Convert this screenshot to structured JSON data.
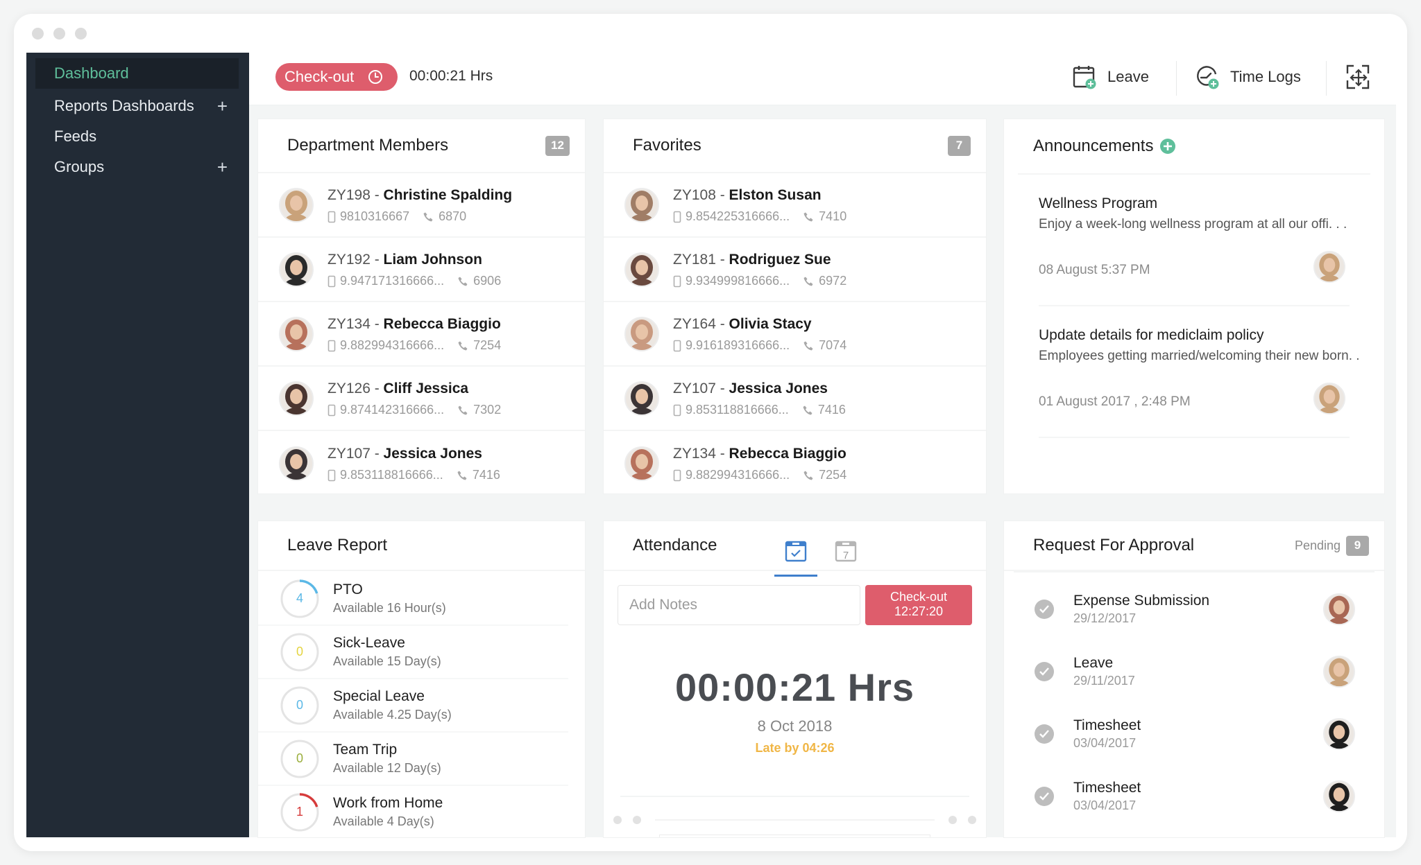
{
  "window": {
    "controls": [
      "close",
      "minimize",
      "maximize"
    ]
  },
  "sidebar": {
    "items": [
      {
        "label": "Dashboard",
        "active": true,
        "has_add": false
      },
      {
        "label": "Reports Dashboards",
        "active": false,
        "has_add": true
      },
      {
        "label": "Feeds",
        "active": false,
        "has_add": false
      },
      {
        "label": "Groups",
        "active": false,
        "has_add": true
      }
    ],
    "add_symbol": "+"
  },
  "topbar": {
    "checkout_label": "Check-out",
    "checkout_icon": "clock-icon",
    "timer": "00:00:21 Hrs",
    "actions": [
      {
        "label": "Leave",
        "icon": "calendar-add-icon"
      },
      {
        "label": "Time Logs",
        "icon": "timelog-add-icon"
      }
    ],
    "expand_icon": "move-expand-icon"
  },
  "colors": {
    "accent_green": "#5fbf9b",
    "checkout_red": "#de5d6c",
    "sidebar_bg": "#222b36",
    "late_amber": "#f0b646",
    "tab_blue": "#3f7fcc"
  },
  "department_members": {
    "title": "Department Members",
    "count": "12",
    "members": [
      {
        "id": "ZY198",
        "sep": " - ",
        "name": "Christine Spalding",
        "mobile": "9810316667",
        "ext": "6870",
        "avatar_color": "#c9a27a"
      },
      {
        "id": "ZY192",
        "sep": " - ",
        "name": "Liam Johnson",
        "mobile": "9.947171316666...",
        "ext": "6906",
        "avatar_color": "#2a2a2a"
      },
      {
        "id": "ZY134",
        "sep": " - ",
        "name": "Rebecca Biaggio",
        "mobile": "9.882994316666...",
        "ext": "7254",
        "avatar_color": "#b7715c"
      },
      {
        "id": "ZY126",
        "sep": " - ",
        "name": "Cliff Jessica",
        "mobile": "9.874142316666...",
        "ext": "7302",
        "avatar_color": "#4a3530"
      },
      {
        "id": "ZY107",
        "sep": " - ",
        "name": "Jessica Jones",
        "mobile": "9.853118816666...",
        "ext": "7416",
        "avatar_color": "#3b3436"
      }
    ]
  },
  "favorites": {
    "title": "Favorites",
    "count": "7",
    "members": [
      {
        "id": "ZY108",
        "sep": " - ",
        "name": "Elston Susan",
        "mobile": "9.854225316666...",
        "ext": "7410",
        "avatar_color": "#a07d66"
      },
      {
        "id": "ZY181",
        "sep": " - ",
        "name": "Rodriguez Sue",
        "mobile": "9.934999816666...",
        "ext": "6972",
        "avatar_color": "#6a4a3f"
      },
      {
        "id": "ZY164",
        "sep": " - ",
        "name": "Olivia Stacy",
        "mobile": "9.916189316666...",
        "ext": "7074",
        "avatar_color": "#c99a80"
      },
      {
        "id": "ZY107",
        "sep": " - ",
        "name": "Jessica Jones",
        "mobile": "9.853118816666...",
        "ext": "7416",
        "avatar_color": "#3b3436"
      },
      {
        "id": "ZY134",
        "sep": " - ",
        "name": "Rebecca Biaggio",
        "mobile": "9.882994316666...",
        "ext": "7254",
        "avatar_color": "#b7715c"
      }
    ]
  },
  "announcements": {
    "title": "Announcements",
    "add_icon": "plus-circle-icon",
    "items": [
      {
        "title": "Wellness Program",
        "description": "Enjoy a week-long wellness program at all our offi. . .",
        "date": "08 August 5:37 PM",
        "avatar_color": "#c9a27a"
      },
      {
        "title": "Update details for mediclaim policy",
        "description": "Employees getting married/welcoming their new born. .",
        "date": "01 August 2017 , 2:48 PM",
        "avatar_color": "#c9a27a"
      }
    ]
  },
  "leave_report": {
    "title": "Leave Report",
    "items": [
      {
        "name": "PTO",
        "value": "4",
        "available": "Available 16 Hour(s)",
        "color": "#5bb8e6",
        "fraction": 0.2
      },
      {
        "name": "Sick-Leave",
        "value": "0",
        "available": "Available 15 Day(s)",
        "color": "#e4d440",
        "fraction": 0
      },
      {
        "name": "Special Leave",
        "value": "0",
        "available": "Available 4.25 Day(s)",
        "color": "#5bb8e6",
        "fraction": 0
      },
      {
        "name": "Team Trip",
        "value": "0",
        "available": "Available 12 Day(s)",
        "color": "#9aae3c",
        "fraction": 0
      },
      {
        "name": "Work from Home",
        "value": "1",
        "available": "Available 4 Day(s)",
        "color": "#d63b3b",
        "fraction": 0.2
      }
    ]
  },
  "attendance": {
    "title": "Attendance",
    "tabs": [
      {
        "icon": "calendar-check-icon",
        "active": true
      },
      {
        "icon": "calendar-week-icon",
        "label": "7",
        "active": false
      }
    ],
    "notes_placeholder": "Add Notes",
    "notes_value": "",
    "checkout_label": "Check-out",
    "checkout_time": "12:27:20",
    "timer": "00:00:21 Hrs",
    "date": "8 Oct 2018",
    "late": "Late by 04:26"
  },
  "approvals": {
    "title": "Request For Approval",
    "pending_label": "Pending",
    "pending_count": "9",
    "items": [
      {
        "title": "Expense Submission",
        "date": "29/12/2017",
        "avatar_color": "#a86754"
      },
      {
        "title": "Leave",
        "date": "29/11/2017",
        "avatar_color": "#c9a27a"
      },
      {
        "title": "Timesheet",
        "date": "03/04/2017",
        "avatar_color": "#1e1e1e"
      },
      {
        "title": "Timesheet",
        "date": "03/04/2017",
        "avatar_color": "#1e1e1e"
      }
    ]
  }
}
